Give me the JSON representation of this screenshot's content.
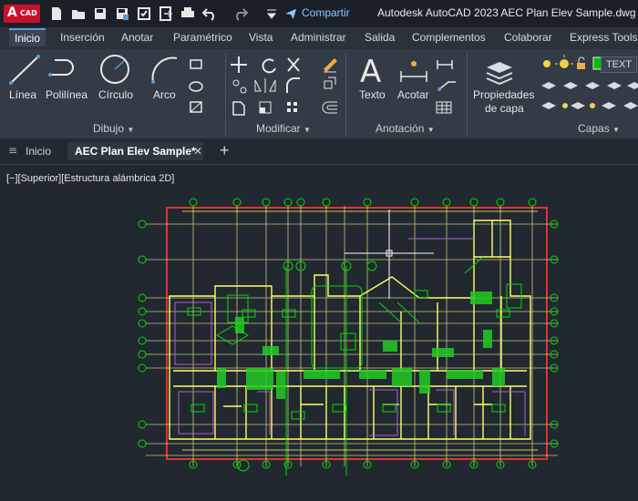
{
  "app": {
    "logo_letter": "A",
    "logo_sub": "CAD",
    "share_label": "Compartir",
    "window_title": "Autodesk AutoCAD 2023   AEC Plan Elev Sample.dwg"
  },
  "ribbon_tabs": [
    "Inicio",
    "Inserción",
    "Anotar",
    "Paramétrico",
    "Vista",
    "Administrar",
    "Salida",
    "Complementos",
    "Colaborar",
    "Express Tools"
  ],
  "ribbon": {
    "tools": {
      "line": "Línea",
      "polyline": "Polilínea",
      "circle": "Círculo",
      "arc": "Arco",
      "text": "Texto",
      "dimension": "Acotar",
      "layer_props_1": "Propiedades",
      "layer_props_2": "de capa",
      "layer_name": "TEXT"
    },
    "panels": {
      "draw": "Dibujo",
      "modify": "Modificar",
      "annotation": "Anotación",
      "layers": "Capas"
    }
  },
  "doc_tabs": {
    "start": "Inicio",
    "active": "AEC Plan Elev Sample*",
    "close": "✕",
    "new": "+"
  },
  "viewport_label": "[−][Superior][Estructura alámbrica 2D]",
  "colors": {
    "canvas_bg": "#212830",
    "walls": "#ffff66",
    "grid": "#ffff99",
    "rooms": "#00dd00",
    "border": "#dd3333",
    "accent": "#5b9bd5"
  }
}
